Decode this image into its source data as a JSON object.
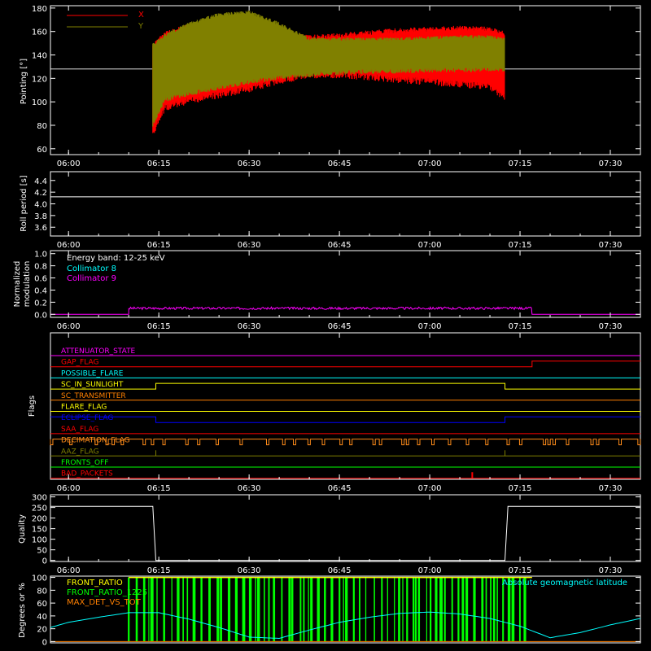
{
  "x_ticks": [
    "06:00",
    "06:15",
    "06:30",
    "06:45",
    "07:00",
    "07:15",
    "07:30"
  ],
  "x_tick_minutes": [
    0,
    15,
    30,
    45,
    60,
    75,
    90
  ],
  "x_range_minutes": [
    -3,
    95
  ],
  "colors": {
    "axes": "#ffffff",
    "red": "#ff0000",
    "olive": "#808000",
    "cyan": "#00ffff",
    "magenta": "#ff00ff",
    "orange": "#ff8000",
    "yellow": "#ffff00",
    "green": "#00ff00",
    "blue": "#0000ff",
    "pale_green": "#00ff80",
    "flag_orange": "#ff8c1a"
  },
  "chart_data": [
    {
      "type": "line",
      "panel": "pointing",
      "ylabel": "Pointing [°]",
      "ylim": [
        55,
        182
      ],
      "yticks": [
        60,
        80,
        100,
        120,
        140,
        160,
        180
      ],
      "legend": [
        "X",
        "Y"
      ],
      "series": [
        {
          "name": "X",
          "x_minutes": [
            14,
            16,
            20,
            25,
            30,
            35,
            40,
            45,
            50,
            55,
            60,
            65,
            70,
            72.5
          ],
          "upper": [
            150,
            160,
            167,
            170,
            168,
            160,
            157,
            159,
            161,
            163,
            164,
            165,
            164,
            160
          ],
          "lower": [
            70,
            92,
            98,
            103,
            108,
            115,
            120,
            120,
            118,
            116,
            114,
            112,
            110,
            100
          ]
        },
        {
          "name": "Y",
          "x_minutes": [
            14,
            16,
            20,
            25,
            30,
            35,
            40,
            45,
            50,
            55,
            60,
            65,
            70,
            72.5
          ],
          "upper": [
            150,
            158,
            168,
            176,
            178,
            168,
            155,
            155,
            155,
            155,
            156,
            157,
            157,
            155
          ],
          "lower": [
            78,
            100,
            105,
            110,
            115,
            119,
            121,
            123,
            124,
            124,
            125,
            125,
            126,
            125
          ]
        }
      ],
      "reference_line": 128
    },
    {
      "type": "line",
      "panel": "roll",
      "ylabel": "Roll period [s]",
      "ylim": [
        3.45,
        4.55
      ],
      "yticks": [
        3.6,
        3.8,
        4.0,
        4.2,
        4.4
      ],
      "series": [
        {
          "name": "",
          "x_minutes": [
            -3,
            95
          ],
          "y": [
            4.12,
            4.12
          ]
        }
      ]
    },
    {
      "type": "line",
      "panel": "modulation",
      "ylabel_lines": [
        "Normalized",
        "modulation"
      ],
      "ylim": [
        -0.05,
        1.05
      ],
      "yticks": [
        0.0,
        0.2,
        0.4,
        0.6,
        0.8,
        1.0
      ],
      "annotations": [
        "Energy band: 12-25 keV",
        "Collimator 8",
        "Collimator 9"
      ],
      "series": [
        {
          "name": "Collimator 9",
          "x_minutes": [
            10,
            77
          ],
          "y_mean": 0.1
        }
      ]
    },
    {
      "type": "table",
      "panel": "flags",
      "ylabel": "Flags",
      "flags": [
        {
          "name": "ATTENUATOR_STATE",
          "color": "#ff00ff",
          "level": 0
        },
        {
          "name": "GAP_FLAG",
          "color": "#ff0000",
          "level": 0,
          "high_from_minutes": 77
        },
        {
          "name": "POSSIBLE_FLARE",
          "color": "#00ffff",
          "level": 0
        },
        {
          "name": "SC_IN_SUNLIGHT",
          "color": "#ffff00",
          "level": 0,
          "high_minutes": [
            14.5,
            72.5
          ]
        },
        {
          "name": "SC_TRANSMITTER",
          "color": "#ff8000",
          "level": 0
        },
        {
          "name": "FLARE_FLAG",
          "color": "#ffff00",
          "level": 0
        },
        {
          "name": "ECLIPSE_FLAG",
          "color": "#0000ff",
          "level": 1,
          "low_minutes": [
            14.5,
            72.5
          ]
        },
        {
          "name": "SAA_FLAG",
          "color": "#ff0000",
          "level": 0
        },
        {
          "name": "DECIMATION_FLAG",
          "color": "#ff8c1a",
          "level": 1
        },
        {
          "name": "AAZ_FLAG",
          "color": "#808000",
          "level": 0
        },
        {
          "name": "FRONTS_OFF",
          "color": "#00ff00",
          "level": 0
        },
        {
          "name": "BAD_PACKETS",
          "color": "#ff0000",
          "level": 0,
          "spike_minutes": 67
        }
      ]
    },
    {
      "type": "line",
      "panel": "quality",
      "ylabel": "Quality",
      "ylim": [
        -5,
        310
      ],
      "yticks": [
        0,
        50,
        100,
        150,
        200,
        250,
        300
      ],
      "series": [
        {
          "name": "",
          "x_minutes": [
            -3,
            14,
            14.5,
            72.5,
            73,
            95
          ],
          "y": [
            255,
            255,
            0,
            0,
            255,
            255
          ]
        }
      ]
    },
    {
      "type": "line",
      "panel": "geomag",
      "ylabel": "Degrees or %",
      "ylim": [
        -2,
        102
      ],
      "yticks": [
        0,
        20,
        40,
        60,
        80,
        100
      ],
      "legend": [
        "FRONT_RATIO",
        "FRONT_RATIO_1225",
        "MAX_DET_VS_TOT"
      ],
      "annotation": "Absolute geomagnetic latitude",
      "series": [
        {
          "name": "Absolute geomagnetic latitude",
          "x_minutes": [
            -3,
            0,
            5,
            10,
            15,
            20,
            25,
            30,
            35,
            40,
            45,
            50,
            55,
            60,
            65,
            70,
            75,
            80,
            85,
            90,
            95
          ],
          "y": [
            22,
            30,
            38,
            45,
            45,
            35,
            22,
            7,
            5,
            18,
            30,
            38,
            44,
            46,
            43,
            36,
            24,
            6,
            14,
            26,
            36
          ]
        },
        {
          "name": "FRONT_RATIO_1225",
          "x_minutes": [
            10,
            77
          ],
          "band": [
            0,
            100
          ]
        }
      ]
    }
  ]
}
